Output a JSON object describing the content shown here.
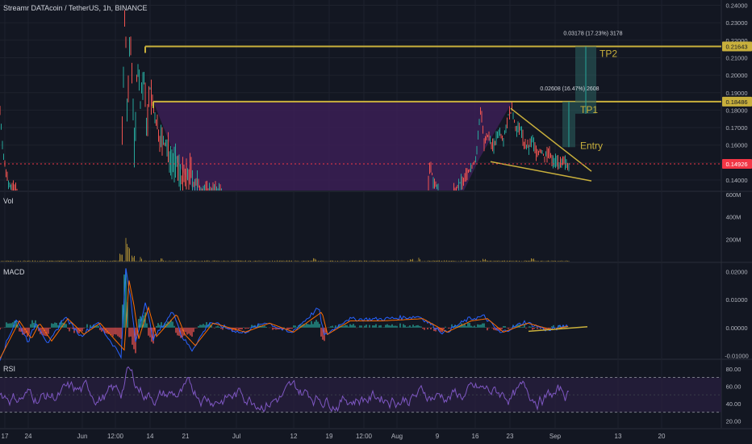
{
  "header": {
    "title": "Streamr DATAcoin / TetherUS, 1h, BINANCE"
  },
  "labels": {
    "vol": "Vol",
    "macd": "MACD",
    "rsi": "RSI"
  },
  "colors": {
    "background": "#131722",
    "grid": "#1e222d",
    "price_up": "#26a69a",
    "price_down": "#ef5350",
    "trendline": "#c9b03c",
    "level_line": "#c9b03c",
    "zone_fill": "#3b1f55",
    "macd_line": "#2962ff",
    "signal_line": "#ff6d00",
    "rsi_line": "#7e57c2",
    "current_price": "#f23645",
    "target_box": "#2a5c5c"
  },
  "chart_data": [
    {
      "type": "line",
      "panel": "price",
      "title": "Streamr DATAcoin / TetherUS, 1h, BINANCE",
      "x_ticks": [
        "17",
        "24",
        "Jun",
        "12:00",
        "14",
        "21",
        "Jul",
        "12",
        "19",
        "12:00",
        "Aug",
        "9",
        "16",
        "23",
        "Sep",
        "13",
        "20"
      ],
      "y_ticks": [
        "0.24000",
        "0.23000",
        "0.22000",
        "0.21000",
        "0.20000",
        "0.19000",
        "0.18000",
        "0.17000",
        "0.16000",
        "0.15000",
        "0.14000"
      ],
      "ylim": [
        0.134,
        0.243
      ],
      "current_price": "0.14926",
      "levels": [
        {
          "name": "TP2",
          "value": "0.21643",
          "measure": "0.03178 (17.23%) 3178"
        },
        {
          "name": "TP1",
          "value": "0.18486",
          "measure": "0.02608 (16.47%) 2608"
        }
      ],
      "annotations": [
        "TP2",
        "TP1",
        "Entry"
      ],
      "entry_price": 0.1588,
      "series_points": [
        [
          0,
          0.18
        ],
        [
          5,
          0.15
        ],
        [
          10,
          0.14
        ],
        [
          15,
          0.135
        ],
        [
          30,
          0.134
        ],
        [
          60,
          0.134
        ],
        [
          100,
          0.134
        ],
        [
          150,
          0.134
        ],
        [
          155,
          0.24
        ],
        [
          158,
          0.17
        ],
        [
          161,
          0.225
        ],
        [
          164,
          0.2
        ],
        [
          167,
          0.15
        ],
        [
          170,
          0.21
        ],
        [
          174,
          0.185
        ],
        [
          178,
          0.2
        ],
        [
          182,
          0.17
        ],
        [
          186,
          0.192
        ],
        [
          190,
          0.18
        ],
        [
          195,
          0.17
        ],
        [
          200,
          0.162
        ],
        [
          205,
          0.16
        ],
        [
          210,
          0.155
        ],
        [
          215,
          0.15
        ],
        [
          220,
          0.148
        ],
        [
          225,
          0.142
        ],
        [
          230,
          0.14
        ],
        [
          236,
          0.145
        ],
        [
          240,
          0.138
        ],
        [
          250,
          0.135
        ],
        [
          300,
          0.134
        ],
        [
          400,
          0.134
        ],
        [
          500,
          0.134
        ],
        [
          530,
          0.134
        ],
        [
          533,
          0.148
        ],
        [
          538,
          0.138
        ],
        [
          545,
          0.134
        ],
        [
          560,
          0.134
        ],
        [
          575,
          0.14
        ],
        [
          582,
          0.146
        ],
        [
          590,
          0.152
        ],
        [
          596,
          0.183
        ],
        [
          600,
          0.16
        ],
        [
          605,
          0.165
        ],
        [
          612,
          0.159
        ],
        [
          618,
          0.168
        ],
        [
          624,
          0.164
        ],
        [
          630,
          0.177
        ],
        [
          635,
          0.18
        ],
        [
          640,
          0.168
        ],
        [
          645,
          0.17
        ],
        [
          650,
          0.16
        ],
        [
          655,
          0.158
        ],
        [
          660,
          0.163
        ],
        [
          665,
          0.155
        ],
        [
          670,
          0.157
        ],
        [
          675,
          0.153
        ],
        [
          680,
          0.156
        ],
        [
          685,
          0.15
        ],
        [
          690,
          0.152
        ],
        [
          695,
          0.148
        ],
        [
          700,
          0.15
        ],
        [
          705,
          0.149
        ]
      ]
    },
    {
      "type": "bar",
      "panel": "volume",
      "y_ticks": [
        "600M",
        "400M",
        "200M"
      ],
      "ylim": [
        0,
        620
      ],
      "spikes": [
        [
          150,
          120
        ],
        [
          157,
          240
        ],
        [
          160,
          160
        ],
        [
          165,
          60
        ],
        [
          175,
          50
        ],
        [
          200,
          30
        ],
        [
          390,
          30
        ],
        [
          510,
          25
        ],
        [
          520,
          35
        ],
        [
          600,
          25
        ],
        [
          660,
          30
        ]
      ]
    },
    {
      "type": "line",
      "panel": "macd",
      "y_ticks": [
        "0.02000",
        "0.01000",
        "0.00000",
        "-0.01000"
      ],
      "ylim": [
        -0.011,
        0.023
      ],
      "spikes": [
        [
          10,
          -0.004
        ],
        [
          20,
          0.003
        ],
        [
          35,
          -0.005
        ],
        [
          45,
          0.002
        ],
        [
          60,
          -0.006
        ],
        [
          80,
          0.004
        ],
        [
          100,
          -0.003
        ],
        [
          120,
          0.002
        ],
        [
          150,
          -0.01
        ],
        [
          156,
          0.021
        ],
        [
          162,
          0.01
        ],
        [
          168,
          -0.005
        ],
        [
          180,
          0.009
        ],
        [
          190,
          -0.004
        ],
        [
          215,
          0.006
        ],
        [
          225,
          -0.003
        ],
        [
          238,
          -0.008
        ],
        [
          260,
          0.002
        ],
        [
          300,
          -0.002
        ],
        [
          330,
          0.002
        ],
        [
          360,
          -0.002
        ],
        [
          395,
          0.007
        ],
        [
          402,
          -0.003
        ],
        [
          430,
          0.003
        ],
        [
          470,
          0.003
        ],
        [
          520,
          0.004
        ],
        [
          550,
          -0.002
        ],
        [
          580,
          0.003
        ],
        [
          600,
          0.004
        ],
        [
          620,
          -0.002
        ],
        [
          650,
          0.002
        ],
        [
          680,
          -0.001
        ],
        [
          705,
          0.001
        ]
      ]
    },
    {
      "type": "line",
      "panel": "rsi",
      "y_ticks": [
        "80.00",
        "60.00",
        "40.00",
        "20.00"
      ],
      "ylim": [
        12,
        90
      ],
      "bands": [
        70,
        30
      ]
    }
  ]
}
